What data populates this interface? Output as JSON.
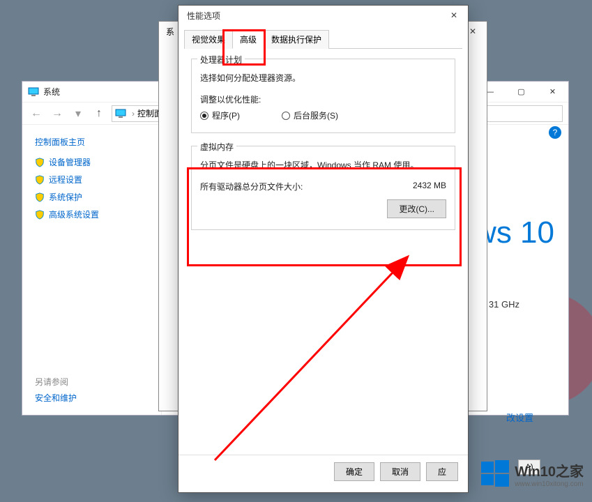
{
  "system_window": {
    "title": "系统",
    "breadcrumb_item": "控制面",
    "sidebar_home": "控制面板主页",
    "links": [
      "设备管理器",
      "远程设置",
      "系统保护",
      "高级系统设置"
    ],
    "see_also_label": "另请参阅",
    "see_also_link": "安全和维护",
    "brand_fragment": "ws 10",
    "ghz_fragment": "31 GHz",
    "change_settings_fragment": "改设置",
    "abox_label": "A)",
    "minimize": "—",
    "maximize": "▢",
    "close": "✕"
  },
  "sysprop_window": {
    "title": "系",
    "close": "✕"
  },
  "perf_window": {
    "title": "性能选项",
    "close": "✕",
    "tabs": [
      "视觉效果",
      "高级",
      "数据执行保护"
    ],
    "processor": {
      "legend": "处理器计划",
      "desc": "选择如何分配处理器资源。",
      "adjust_label": "调整以优化性能:",
      "opt_programs": "程序(P)",
      "opt_services": "后台服务(S)"
    },
    "vm": {
      "legend": "虚拟内存",
      "desc": "分页文件是硬盘上的一块区域，Windows 当作 RAM 使用。",
      "total_label": "所有驱动器总分页文件大小:",
      "total_value": "2432 MB",
      "change_btn": "更改(C)..."
    },
    "ok": "确定",
    "cancel": "取消",
    "apply": "应"
  },
  "watermark": {
    "line1": "Win10之家",
    "line2": "www.win10xitong.com"
  }
}
